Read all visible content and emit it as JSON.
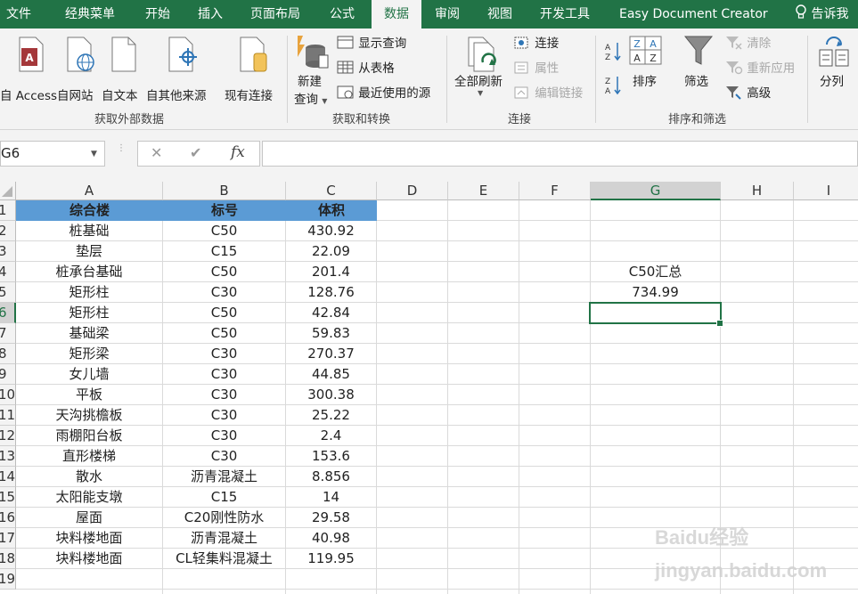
{
  "menu": {
    "file": "文件",
    "classic": "经典菜单",
    "home": "开始",
    "insert": "插入",
    "layout": "页面布局",
    "formulas": "公式",
    "data": "数据",
    "review": "审阅",
    "view": "视图",
    "developer": "开发工具",
    "edc": "Easy Document Creator",
    "tell": "告诉我"
  },
  "ribbon": {
    "access": "Access",
    "web": "自网站",
    "text": "自文本",
    "other": "自其他来源",
    "existing": "现有连接",
    "new_query_1": "新建",
    "new_query_2": "查询",
    "show_queries": "显示查询",
    "from_table": "从表格",
    "recent_sources": "最近使用的源",
    "refresh_all": "全部刷新",
    "connections": "连接",
    "properties": "属性",
    "edit_links": "编辑链接",
    "sort": "排序",
    "filter": "筛选",
    "clear": "清除",
    "reapply": "重新应用",
    "advanced": "高级",
    "split": "分列",
    "group_external": "获取外部数据",
    "group_transform": "获取和转换",
    "group_connections": "连接",
    "group_sortfilter": "排序和筛选",
    "sort_az": "A Z",
    "sort_za": "Z A"
  },
  "formula_bar": {
    "name_box": "G6",
    "cancel": "✕",
    "enter": "✔",
    "fx": "fx",
    "formula": ""
  },
  "columns": [
    "A",
    "B",
    "C",
    "D",
    "E",
    "F",
    "G",
    "H",
    "I"
  ],
  "rows": [
    "1",
    "2",
    "3",
    "4",
    "5",
    "6",
    "7",
    "8",
    "9",
    "10",
    "11",
    "12",
    "13",
    "14",
    "15",
    "16",
    "17",
    "18",
    "19"
  ],
  "table": {
    "header": [
      "综合楼",
      "标号",
      "体积"
    ],
    "rows": [
      [
        "桩基础",
        "C50",
        "430.92"
      ],
      [
        "垫层",
        "C15",
        "22.09"
      ],
      [
        "桩承台基础",
        "C50",
        "201.4"
      ],
      [
        "矩形柱",
        "C30",
        "128.76"
      ],
      [
        "矩形柱",
        "C50",
        "42.84"
      ],
      [
        "基础梁",
        "C50",
        "59.83"
      ],
      [
        "矩形梁",
        "C30",
        "270.37"
      ],
      [
        "女儿墙",
        "C30",
        "44.85"
      ],
      [
        "平板",
        "C30",
        "300.38"
      ],
      [
        "天沟挑檐板",
        "C30",
        "25.22"
      ],
      [
        "雨棚阳台板",
        "C30",
        "2.4"
      ],
      [
        "直形楼梯",
        "C30",
        "153.6"
      ],
      [
        "散水",
        "沥青混凝土",
        "8.856"
      ],
      [
        "太阳能支墩",
        "C15",
        "14"
      ],
      [
        "屋面",
        "C20刚性防水",
        "29.58"
      ],
      [
        "块料楼地面",
        "沥青混凝土",
        "40.98"
      ],
      [
        "块料楼地面",
        "CL轻集料混凝土",
        "119.95"
      ]
    ]
  },
  "summary": {
    "label": "C50汇总",
    "value": "734.99"
  },
  "watermark": "Baidu经验 jingyan.baidu.com",
  "colors": {
    "excel_green": "#217346",
    "header_fill": "#5b9bd5",
    "ribbon_bg": "#f3f3f3"
  }
}
